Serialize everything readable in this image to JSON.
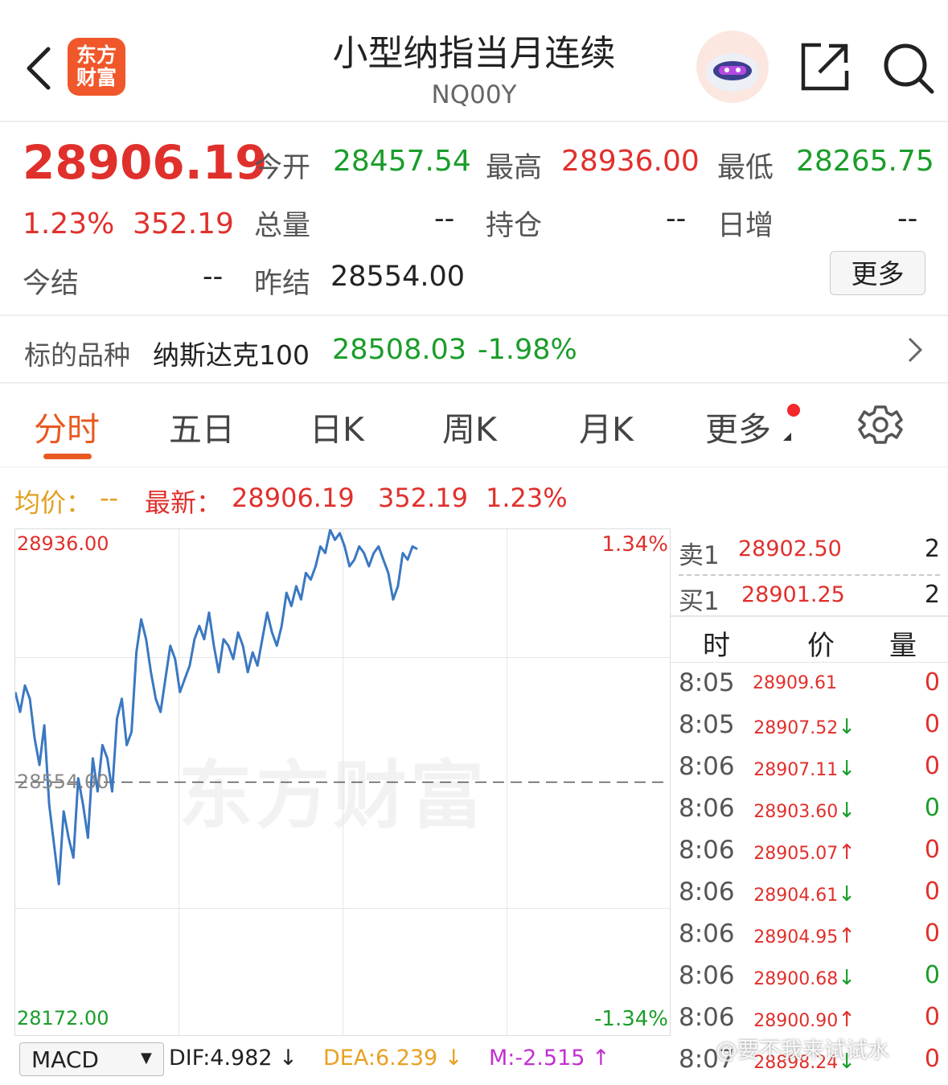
{
  "header": {
    "back_icon": "chevron-left-icon",
    "logo_line1": "东方",
    "logo_line2": "财富",
    "title": "小型纳指当月连续",
    "code": "NQ00Y",
    "share_icon": "share-icon",
    "search_icon": "search-icon"
  },
  "quote": {
    "price": "28906.19",
    "change_pct": "1.23%",
    "change": "352.19",
    "open_label": "今开",
    "open": "28457.54",
    "high_label": "最高",
    "high": "28936.00",
    "low_label": "最低",
    "low": "28265.75",
    "volume_label": "总量",
    "volume": "--",
    "position_label": "持仓",
    "position": "--",
    "daily_inc_label": "日增",
    "daily_inc": "--",
    "settle_label": "今结",
    "settle": "--",
    "prev_settle_label": "昨结",
    "prev_settle": "28554.00",
    "more_button": "更多"
  },
  "underlying": {
    "label": "标的品种",
    "name": "纳斯达克100",
    "price": "28508.03",
    "change_pct": "-1.98%"
  },
  "tabs": [
    "分时",
    "五日",
    "日K",
    "周K",
    "月K",
    "更多"
  ],
  "tabs_active": "分时",
  "info_bar": {
    "avg_label": "均价：",
    "avg": "--",
    "latest_label": "最新：",
    "latest": "28906.19",
    "change": "352.19",
    "pct": "1.23%"
  },
  "chart_labels": {
    "top_price": "28936.00",
    "mid_price": "28554.00",
    "bottom_price": "28172.00",
    "top_pct": "1.34%",
    "bottom_pct": "-1.34%",
    "watermark": "东方财富"
  },
  "chart_data": {
    "type": "line",
    "series": [
      {
        "values": [
          28690,
          28660,
          28700,
          28680,
          28620,
          28580,
          28640,
          28520,
          28460,
          28400,
          28510,
          28470,
          28440,
          28560,
          28520,
          28470,
          28590,
          28540,
          28610,
          28590,
          28540,
          28650,
          28680,
          28610,
          28630,
          28750,
          28800,
          28770,
          28720,
          28680,
          28660,
          28710,
          28760,
          28740,
          28690,
          28710,
          28730,
          28770,
          28790,
          28770,
          28810,
          28760,
          28720,
          28770,
          28760,
          28740,
          28780,
          28760,
          28720,
          28750,
          28730,
          28770,
          28810,
          28780,
          28760,
          28790,
          28840,
          28820,
          28850,
          28830,
          28870,
          28860,
          28880,
          28910,
          28900,
          28935,
          28920,
          28930,
          28910,
          28880,
          28890,
          28910,
          28900,
          28880,
          28900,
          28910,
          28890,
          28870,
          28830,
          28850,
          28900,
          28890,
          28910,
          28906
        ]
      }
    ],
    "ylim": [
      28172.0,
      28936.0
    ],
    "reference": 28554.0,
    "grid": true
  },
  "order_book": {
    "sell_label": "卖1",
    "sell_price": "28902.50",
    "sell_qty": "2",
    "buy_label": "买1",
    "buy_price": "28901.25",
    "buy_qty": "2"
  },
  "ticks_header": {
    "time": "时",
    "price": "价",
    "qty": "量"
  },
  "ticks": [
    {
      "time": "8:05",
      "price": "28909.61",
      "arrow": "",
      "qty": "0",
      "qty_color": "red"
    },
    {
      "time": "8:05",
      "price": "28907.52",
      "arrow": "↓",
      "qty": "0",
      "qty_color": "red"
    },
    {
      "time": "8:06",
      "price": "28907.11",
      "arrow": "↓",
      "qty": "0",
      "qty_color": "red"
    },
    {
      "time": "8:06",
      "price": "28903.60",
      "arrow": "↓",
      "qty": "0",
      "qty_color": "green"
    },
    {
      "time": "8:06",
      "price": "28905.07",
      "arrow": "↑",
      "qty": "0",
      "qty_color": "red"
    },
    {
      "time": "8:06",
      "price": "28904.61",
      "arrow": "↓",
      "qty": "0",
      "qty_color": "red"
    },
    {
      "time": "8:06",
      "price": "28904.95",
      "arrow": "↑",
      "qty": "0",
      "qty_color": "red"
    },
    {
      "time": "8:06",
      "price": "28900.68",
      "arrow": "↓",
      "qty": "0",
      "qty_color": "green"
    },
    {
      "time": "8:06",
      "price": "28900.90",
      "arrow": "↑",
      "qty": "0",
      "qty_color": "red"
    },
    {
      "time": "8:07",
      "price": "28898.24",
      "arrow": "↓",
      "qty": "0",
      "qty_color": "red"
    }
  ],
  "macd": {
    "selector": "MACD",
    "dif": "DIF:4.982 ↓",
    "dea": "DEA:6.239 ↓",
    "m": "M:-2.515 ↑"
  },
  "weibo_watermark": "@要不我来试试水",
  "colors": {
    "red": "#e0302c",
    "green": "#1a9d2a",
    "orange": "#e85a22",
    "line": "#3a78c2"
  }
}
